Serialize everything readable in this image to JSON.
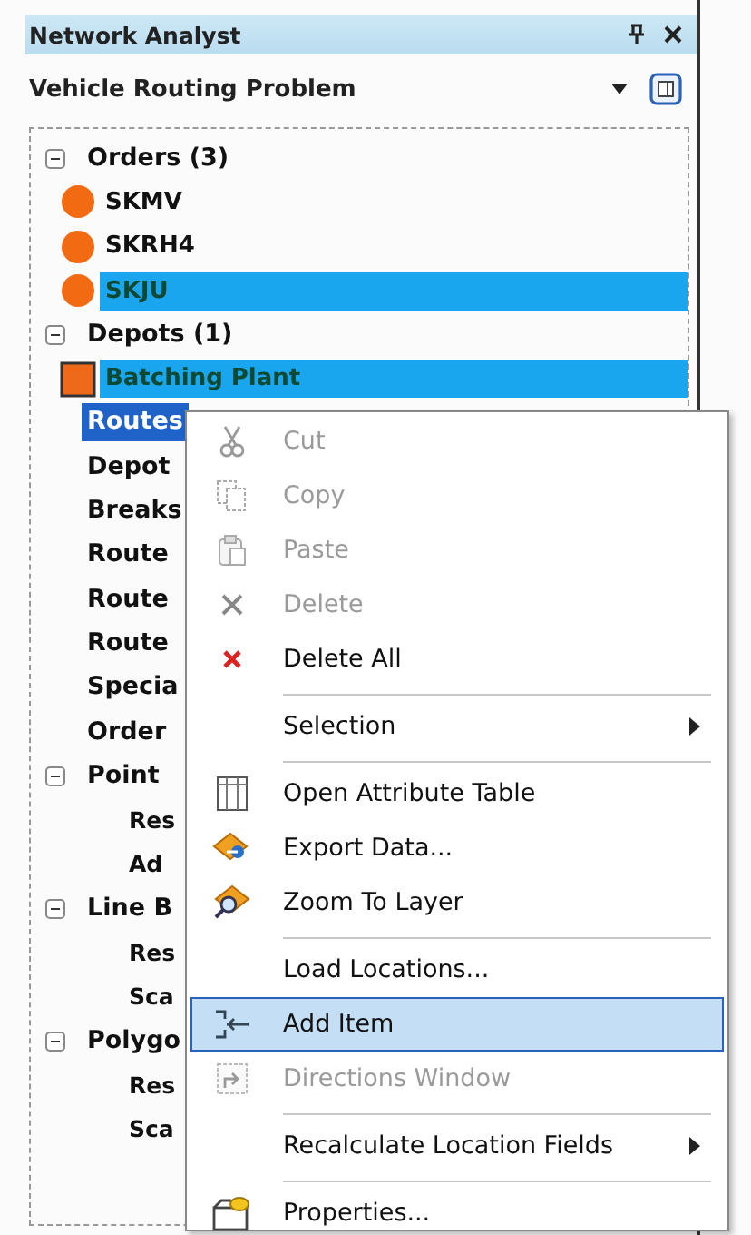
{
  "panel": {
    "title": "Network Analyst"
  },
  "analysis_layer": {
    "value": "Vehicle Routing Problem"
  },
  "tree": [
    {
      "kind": "group",
      "label": "Orders (3)",
      "expanded": true,
      "selected": false,
      "children": [
        {
          "kind": "order",
          "label": "SKMV",
          "selected": false
        },
        {
          "kind": "order",
          "label": "SKRH4",
          "selected": false
        },
        {
          "kind": "order",
          "label": "SKJU",
          "selected": true
        }
      ]
    },
    {
      "kind": "group",
      "label": "Depots (1)",
      "expanded": true,
      "selected": false,
      "children": [
        {
          "kind": "depot",
          "label": "Batching Plant",
          "selected": true
        }
      ]
    },
    {
      "kind": "class",
      "label": "Routes",
      "selected": true,
      "focused": true
    },
    {
      "kind": "class",
      "label": "Depot",
      "selected": false
    },
    {
      "kind": "class",
      "label": "Breaks",
      "selected": false
    },
    {
      "kind": "class",
      "label": "Route",
      "selected": false
    },
    {
      "kind": "class",
      "label": "Route",
      "selected": false
    },
    {
      "kind": "class",
      "label": "Route",
      "selected": false
    },
    {
      "kind": "class",
      "label": "Specia",
      "selected": false
    },
    {
      "kind": "class",
      "label": "Order",
      "selected": false
    },
    {
      "kind": "group",
      "label": "Point",
      "expanded": true,
      "selected": false,
      "children": [
        {
          "kind": "sub",
          "label": "Res",
          "selected": false
        },
        {
          "kind": "sub",
          "label": "Ad",
          "selected": false
        }
      ]
    },
    {
      "kind": "group",
      "label": "Line B",
      "expanded": true,
      "selected": false,
      "children": [
        {
          "kind": "sub",
          "label": "Res",
          "selected": false
        },
        {
          "kind": "sub",
          "label": "Sca",
          "selected": false
        }
      ]
    },
    {
      "kind": "group",
      "label": "Polygo",
      "expanded": true,
      "selected": false,
      "children": [
        {
          "kind": "sub",
          "label": "Res",
          "selected": false
        },
        {
          "kind": "sub",
          "label": "Sca",
          "selected": false
        }
      ]
    }
  ],
  "context_menu": [
    {
      "label": "Cut",
      "disabled": true,
      "selected": false,
      "submenu": false,
      "separator_before": false
    },
    {
      "label": "Copy",
      "disabled": true,
      "selected": false,
      "submenu": false,
      "separator_before": false
    },
    {
      "label": "Paste",
      "disabled": true,
      "selected": false,
      "submenu": false,
      "separator_before": false
    },
    {
      "label": "Delete",
      "disabled": true,
      "selected": false,
      "submenu": false,
      "separator_before": false
    },
    {
      "label": "Delete All",
      "disabled": false,
      "selected": false,
      "submenu": false,
      "separator_before": false
    },
    {
      "label": "Selection",
      "disabled": false,
      "selected": false,
      "submenu": true,
      "separator_before": true
    },
    {
      "label": "Open Attribute Table",
      "disabled": false,
      "selected": false,
      "submenu": false,
      "separator_before": true
    },
    {
      "label": "Export Data...",
      "disabled": false,
      "selected": false,
      "submenu": false,
      "separator_before": false
    },
    {
      "label": "Zoom To Layer",
      "disabled": false,
      "selected": false,
      "submenu": false,
      "separator_before": false
    },
    {
      "label": "Load Locations...",
      "disabled": false,
      "selected": false,
      "submenu": false,
      "separator_before": true
    },
    {
      "label": "Add Item",
      "disabled": false,
      "selected": true,
      "submenu": false,
      "separator_before": false
    },
    {
      "label": "Directions Window",
      "disabled": true,
      "selected": false,
      "submenu": false,
      "separator_before": false
    },
    {
      "label": "Recalculate Location Fields",
      "disabled": false,
      "selected": false,
      "submenu": true,
      "separator_before": true
    },
    {
      "label": "Properties...",
      "disabled": false,
      "selected": false,
      "submenu": false,
      "separator_before": true
    }
  ]
}
